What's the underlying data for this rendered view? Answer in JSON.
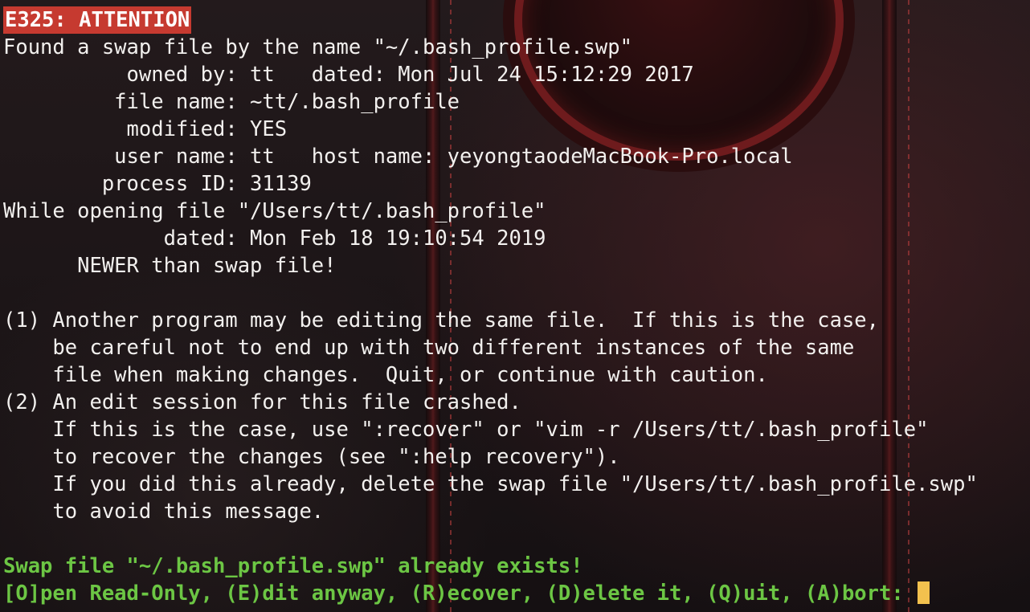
{
  "terminal": {
    "error_tag": "E325: ATTENTION",
    "lines": [
      "Found a swap file by the name \"~/.bash_profile.swp\"",
      "          owned by: tt   dated: Mon Jul 24 15:12:29 2017",
      "         file name: ~tt/.bash_profile",
      "          modified: YES",
      "         user name: tt   host name: yeyongtaodeMacBook-Pro.local",
      "        process ID: 31139",
      "While opening file \"/Users/tt/.bash_profile\"",
      "             dated: Mon Feb 18 19:10:54 2019",
      "      NEWER than swap file!",
      "",
      "(1) Another program may be editing the same file.  If this is the case,",
      "    be careful not to end up with two different instances of the same",
      "    file when making changes.  Quit, or continue with caution.",
      "(2) An edit session for this file crashed.",
      "    If this is the case, use \":recover\" or \"vim -r /Users/tt/.bash_profile\"",
      "    to recover the changes (see \":help recovery\").",
      "    If you did this already, delete the swap file \"/Users/tt/.bash_profile.swp\"",
      "    to avoid this message.",
      ""
    ],
    "swap_exists": "Swap file \"~/.bash_profile.swp\" already exists!",
    "prompt": "[O]pen Read-Only, (E)dit anyway, (R)ecover, (D)elete it, (Q)uit, (A)bort: "
  },
  "colors": {
    "error_bg": "#c63a30",
    "text": "#f2f0ee",
    "prompt": "#6cc644",
    "cursor": "#f2c14e"
  }
}
